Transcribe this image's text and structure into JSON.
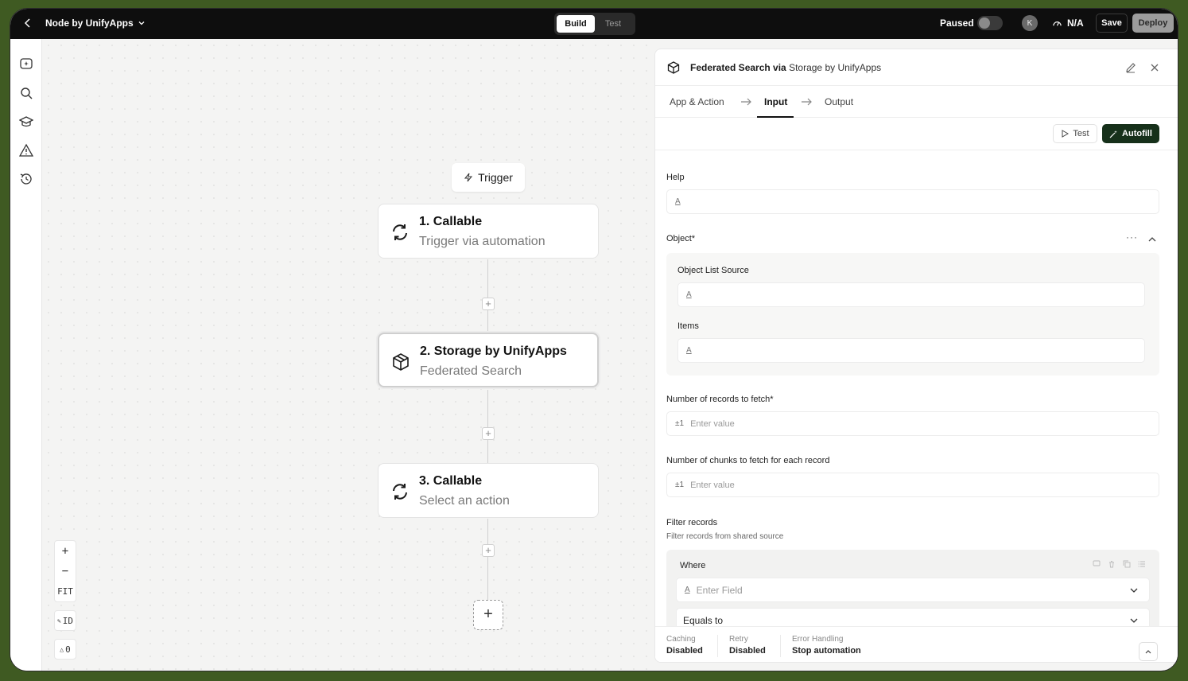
{
  "topbar": {
    "title": "Node by UnifyApps",
    "tabs": [
      {
        "label": "Build"
      },
      {
        "label": "Test"
      }
    ],
    "paused_label": "Paused",
    "avatar_initial": "K",
    "status": "N/A",
    "save_label": "Save",
    "deploy_label": "Deploy"
  },
  "canvas": {
    "trigger_label": "Trigger",
    "nodes": [
      {
        "title": "1. Callable",
        "subtitle": "Trigger via automation"
      },
      {
        "title": "2. Storage by UnifyApps",
        "subtitle": "Federated Search"
      },
      {
        "title": "3. Callable",
        "subtitle": "Select an action"
      }
    ],
    "zoom": {
      "in": "+",
      "out": "−",
      "fit": "FIT",
      "id": "ID",
      "warnings": "0"
    }
  },
  "panel": {
    "title_action": "Federated Search via",
    "title_app": "Storage by UnifyApps",
    "tabs": [
      {
        "label": "App & Action"
      },
      {
        "label": "Input"
      },
      {
        "label": "Output"
      }
    ],
    "test_label": "Test",
    "autofill_label": "Autofill",
    "help_label": "Help",
    "object_label": "Object*",
    "object_list_source_label": "Object List Source",
    "items_label": "Items",
    "records_label": "Number of records to fetch*",
    "records_placeholder": "Enter value",
    "chunks_label": "Number of chunks to fetch for each record",
    "chunks_placeholder": "Enter value",
    "number_prefix": "±1",
    "filter_label": "Filter records",
    "filter_desc": "Filter records from shared source",
    "where_label": "Where",
    "field_placeholder": "Enter Field",
    "operator_value": "Equals to",
    "footer": [
      {
        "key": "Caching",
        "value": "Disabled"
      },
      {
        "key": "Retry",
        "value": "Disabled"
      },
      {
        "key": "Error Handling",
        "value": "Stop automation"
      }
    ]
  }
}
